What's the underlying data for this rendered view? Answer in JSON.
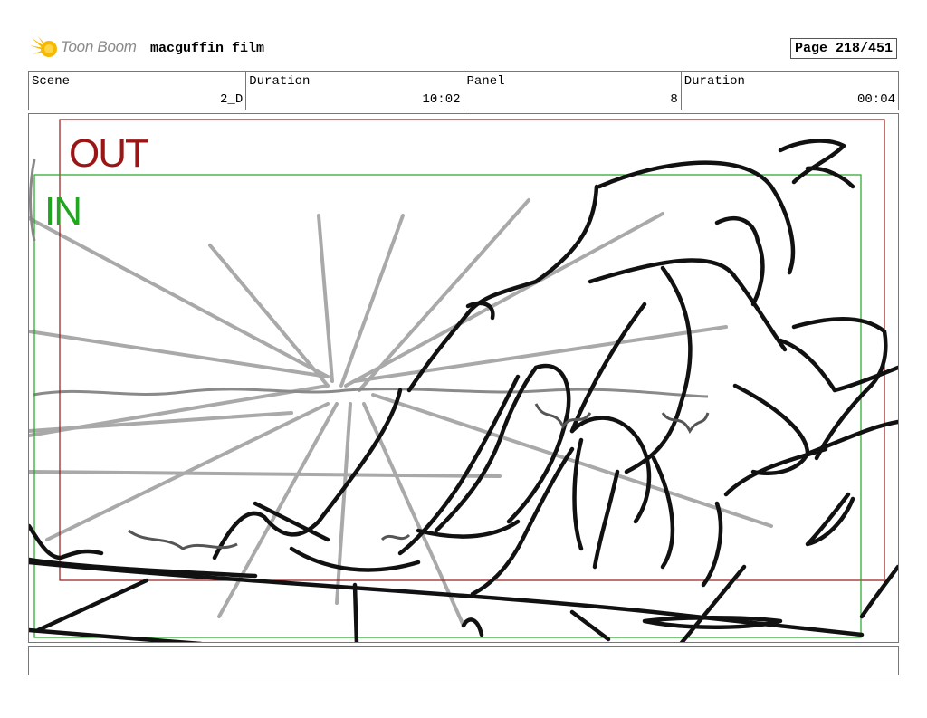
{
  "header": {
    "logo_text": "Toon Boom",
    "film_title": "macguffin film",
    "page_label": "Page 218/451"
  },
  "info": [
    {
      "label": "Scene",
      "value": "2_D"
    },
    {
      "label": "Duration",
      "value": "10:02"
    },
    {
      "label": "Panel",
      "value": "8"
    },
    {
      "label": "Duration",
      "value": "00:04"
    }
  ],
  "panel": {
    "out_label": "OUT",
    "in_label": "IN",
    "out_frame_color": "#9a1515",
    "in_frame_color": "#22a522"
  },
  "caption": {
    "text": ""
  },
  "icons": {
    "logo": "toon-boom-star-icon"
  }
}
